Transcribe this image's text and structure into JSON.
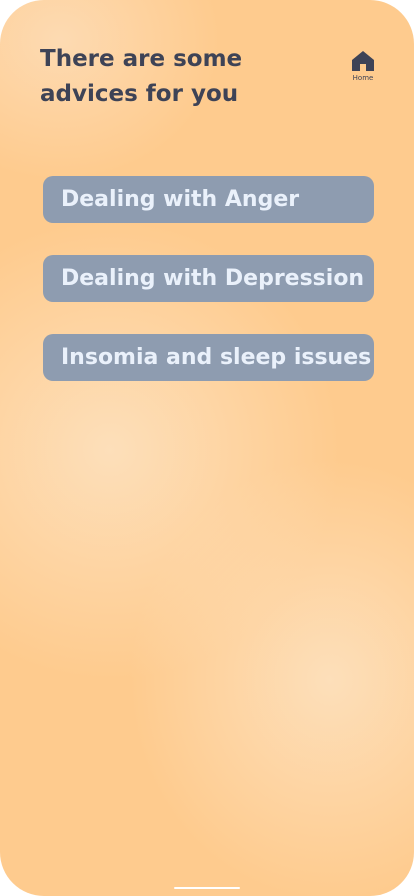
{
  "header": {
    "title": "There are some\nadvices for you"
  },
  "home_button": {
    "icon": "home-icon",
    "label": "Home",
    "color": "#3e4356"
  },
  "advices": [
    {
      "label": "Dealing with Anger"
    },
    {
      "label": "Dealing with Depression"
    },
    {
      "label": "Insomia and sleep issues"
    }
  ],
  "colors": {
    "background": "#fecb8e",
    "button": "#8e9cb0",
    "button_text": "#eaf1fb",
    "title_text": "#3e4356"
  }
}
